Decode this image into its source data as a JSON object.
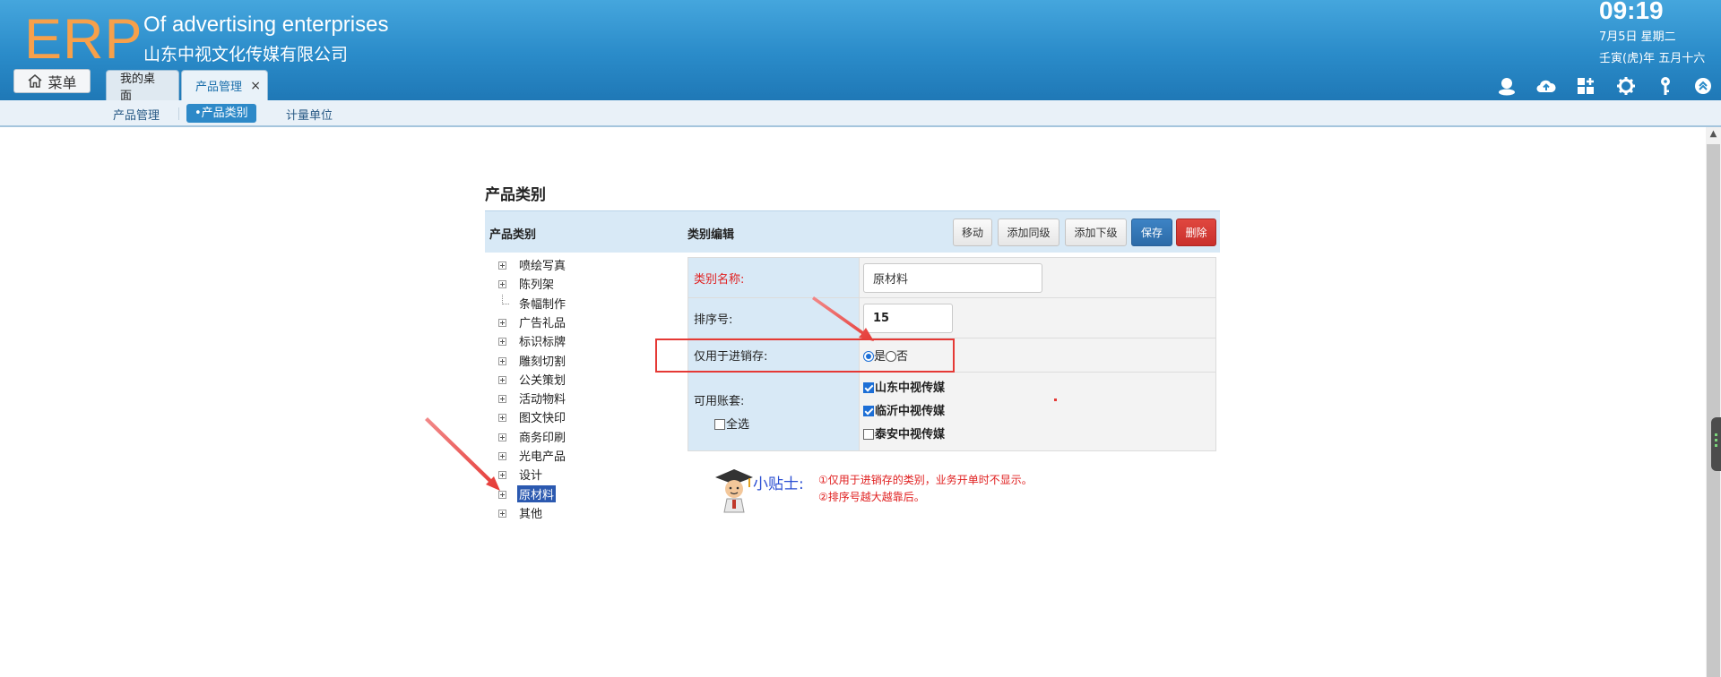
{
  "app": {
    "logo": "ERP",
    "company_en": "Of advertising enterprises",
    "company_cn": "山东中视文化传媒有限公司"
  },
  "clock": {
    "time": "09:19",
    "date": "7月5日 星期二",
    "lunar": "壬寅(虎)年 五月十六"
  },
  "menu_button": {
    "label": "菜单"
  },
  "tabs": [
    {
      "label": "我的桌面",
      "active": false
    },
    {
      "label": "产品管理",
      "active": true,
      "close": "×"
    }
  ],
  "header_icons": [
    "user-icon",
    "cloud-upload-icon",
    "apps-icon",
    "gear-icon",
    "key-icon",
    "collapse-up-icon"
  ],
  "subnav": [
    {
      "label": "产品管理",
      "active": false
    },
    {
      "label": "•产品类别",
      "active": true
    },
    {
      "label": "计量单位",
      "active": false
    }
  ],
  "page": {
    "title": "产品类别"
  },
  "panel": {
    "left_title": "产品类别",
    "right_title": "类别编辑",
    "buttons": {
      "move": "移动",
      "add_sibling": "添加同级",
      "add_child": "添加下级",
      "save": "保存",
      "delete": "删除"
    }
  },
  "tree": [
    {
      "label": "喷绘写真",
      "expandable": true
    },
    {
      "label": "陈列架",
      "expandable": true
    },
    {
      "label": "条幅制作",
      "expandable": false
    },
    {
      "label": "广告礼品",
      "expandable": true
    },
    {
      "label": "标识标牌",
      "expandable": true
    },
    {
      "label": "雕刻切割",
      "expandable": true
    },
    {
      "label": "公关策划",
      "expandable": true
    },
    {
      "label": "活动物料",
      "expandable": true
    },
    {
      "label": "图文快印",
      "expandable": true
    },
    {
      "label": "商务印刷",
      "expandable": true
    },
    {
      "label": "光电产品",
      "expandable": true
    },
    {
      "label": "设计",
      "expandable": true
    },
    {
      "label": "原材料",
      "expandable": true,
      "selected": true
    },
    {
      "label": "其他",
      "expandable": true
    }
  ],
  "form": {
    "name_label": "类别名称:",
    "name_value": "原材料",
    "sort_label": "排序号:",
    "sort_value": "15",
    "stock_only_label": "仅用于进销存:",
    "stock_yes": "是",
    "stock_no": "否",
    "stock_only_value": "是",
    "accounts_label": "可用账套:",
    "select_all_label": "全选",
    "select_all_checked": false,
    "accounts": [
      {
        "label": "山东中视传媒",
        "checked": true
      },
      {
        "label": "临沂中视传媒",
        "checked": true
      },
      {
        "label": "泰安中视传媒",
        "checked": false
      }
    ]
  },
  "tips": {
    "title": "小贴士:",
    "line1": "①仅用于进销存的类别，业务开单时不显示。",
    "line2": "②排序号越大越靠后。"
  },
  "colors": {
    "header_blue": "#2a8bc9",
    "logo_orange": "#f7a04a",
    "accent_blue": "#2d89c8",
    "highlight_red": "#e53935"
  }
}
